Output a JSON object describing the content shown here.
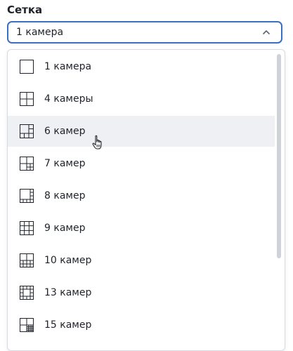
{
  "field": {
    "label": "Сетка",
    "selected_value": "1 камера"
  },
  "dropdown": {
    "options": [
      {
        "label": "1 камера",
        "icon": "grid-1-icon"
      },
      {
        "label": "4 камеры",
        "icon": "grid-4-icon"
      },
      {
        "label": "6 камер",
        "icon": "grid-6-icon",
        "hovered": true
      },
      {
        "label": "7 камер",
        "icon": "grid-7-icon"
      },
      {
        "label": "8 камер",
        "icon": "grid-8-icon"
      },
      {
        "label": "9 камер",
        "icon": "grid-9-icon"
      },
      {
        "label": "10 камер",
        "icon": "grid-10-icon"
      },
      {
        "label": "13 камер",
        "icon": "grid-13-icon"
      },
      {
        "label": "15 камер",
        "icon": "grid-15-icon"
      }
    ]
  },
  "colors": {
    "accent": "#3a6fc4",
    "hover": "#eef0f3",
    "text": "#1f2329"
  }
}
